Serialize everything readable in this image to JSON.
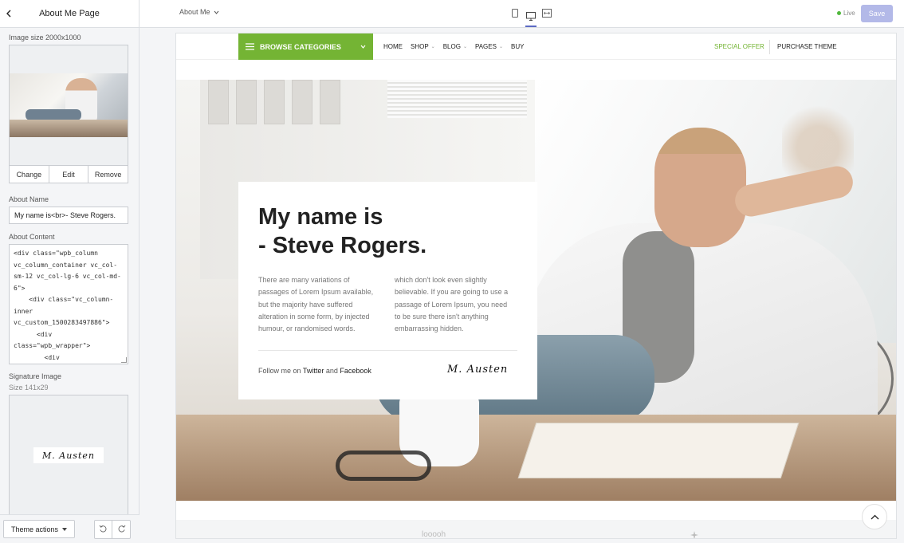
{
  "sidebar": {
    "title": "About Me Page",
    "image_label": "Image size 2000x1000",
    "image_buttons": {
      "change": "Change",
      "edit": "Edit",
      "remove": "Remove"
    },
    "name_label": "About Name",
    "name_value": "My name is<br>- Steve Rogers.",
    "content_label": "About Content",
    "content_value": "<div class=\"wpb_column\nvc_column_container vc_col-\nsm-12 vc_col-lg-6 vc_col-md-\n6\">\n    <div class=\"vc_column-\ninner\nvc_custom_1500283497886\">\n      <div\nclass=\"wpb_wrapper\">\n        <div",
    "signature_label": "Signature Image",
    "signature_size": "Size 141x29",
    "signature_text": "M. Austen",
    "theme_actions": "Theme actions"
  },
  "topbar": {
    "page_select": "About Me",
    "live": "Live",
    "save": "Save"
  },
  "preview": {
    "browse": "BROWSE CATEGORIES",
    "menu": [
      "HOME",
      "SHOP",
      "BLOG",
      "PAGES",
      "BUY"
    ],
    "special_offer": "SPECIAL OFFER",
    "purchase_theme": "PURCHASE THEME",
    "card": {
      "title_line1": "My name is",
      "title_line2": "- Steve Rogers.",
      "col1": "There are many variations of passages of Lorem Ipsum available, but the majority have suffered alteration in some form, by injected humour, or randomised words.",
      "col2": "which don't look even slightly believable. If you are going to use a passage of Lorem Ipsum, you need to be sure there isn't anything embarrassing hidden.",
      "follow_prefix": "Follow me on ",
      "twitter": "Twitter",
      "follow_and": " and ",
      "facebook": "Facebook",
      "signature": "M. Austen"
    },
    "logo_text": "looooh"
  },
  "colors": {
    "accent_green": "#74b434",
    "save_disabled": "#b3b9e8",
    "live_dot": "#50b83c"
  }
}
